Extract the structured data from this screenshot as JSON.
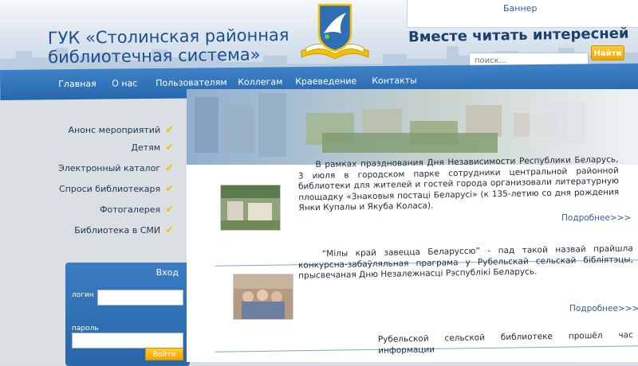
{
  "header": {
    "title_line1": "ГУК «Столинская районная",
    "title_line2": "библиотечная система»",
    "slogan": "Вместе читать интересней",
    "banner_label": "Баннер"
  },
  "search": {
    "placeholder": "поиск...",
    "button": "Найти"
  },
  "nav": [
    "Главная",
    "О нас",
    "Пользователям",
    "Коллегам",
    "Краеведение",
    "Контакты"
  ],
  "sidebar": {
    "items": [
      "Анонс мероприятий",
      "Детям",
      "Электронный каталог",
      "Спроси библиотекаря",
      "Фотогалерея",
      "Библиотека в СМИ"
    ]
  },
  "login": {
    "title": "Вход",
    "login_label": "логин",
    "password_label": "пароль",
    "button": "Войти"
  },
  "news": [
    {
      "text": "В рамках празднования Дня Независимости Республики Беларусь, 3 июля в городском парке сотрудники центральной районной библиотеки для жителей и гостей города организовали литературную площадку «Знаковыя постаці Беларусі» (к 135-летию со дня рождения Янки Купалы и Якуба Коласа).",
      "more": "Подробнее>>>"
    },
    {
      "text": "“Мілы край завецца Беларуссю” - пад такой назвай прайшла конкурсна-забаўляльная праграма у Рубельскай сельскай бібліятэцы, прысвечаная Дню Незалежнасці Рэспублікі Беларусь.",
      "more": "Подробнее>>>"
    },
    {
      "text": "Рубельской сельской библиотеке прошёл час информации"
    }
  ],
  "colors": {
    "nav_blue": "#2f72b8",
    "accent_yellow": "#f5b400",
    "title_blue": "#1b4f8f"
  }
}
